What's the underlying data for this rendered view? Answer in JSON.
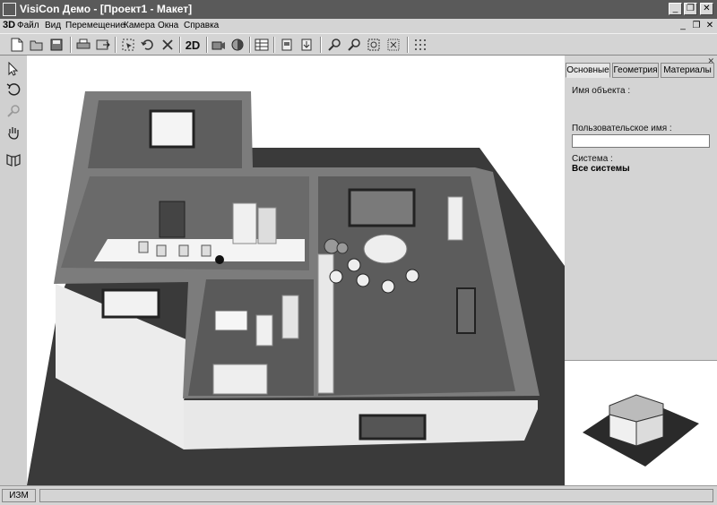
{
  "window": {
    "title": "VisiCon Демо - [Проект1 - Макет]",
    "min_glyph": "_",
    "restore_glyph": "❐",
    "close_glyph": "✕"
  },
  "menubar": {
    "logo": "3D",
    "items": [
      "Файл",
      "Вид",
      "Перемещение",
      "Камера",
      "Окна",
      "Справка"
    ],
    "mdi_min": "_",
    "mdi_restore": "❐",
    "mdi_close": "✕"
  },
  "toolbar": {
    "mode_2d_label": "2D",
    "icons": [
      "new-file-icon",
      "open-file-icon",
      "save-icon",
      "print-icon",
      "export-icon",
      "select-region-icon",
      "undo-icon",
      "delete-icon",
      "camera-view-icon",
      "render-icon",
      "table-grid-icon",
      "page-icon",
      "page-settings-icon",
      "zoom-in-icon",
      "zoom-out-icon",
      "zoom-extents-icon",
      "zoom-window-icon",
      "grid-icon"
    ]
  },
  "left_toolbar": {
    "icons": [
      "pointer-icon",
      "rotate-icon",
      "zoom-icon",
      "pan-hand-icon",
      "walk-through-icon"
    ]
  },
  "right_panel": {
    "close_glyph": "✕",
    "tabs": [
      "Основные",
      "Геометрия",
      "Материалы"
    ],
    "object_name_label": "Имя объекта :",
    "user_name_label": "Пользовательское имя :",
    "user_name_value": "",
    "system_label": "Система :",
    "system_value": "Все системы"
  },
  "status_bar": {
    "mode": "ИЗМ"
  },
  "colors": {
    "titlebar": "#5a5a5a",
    "floor_dark": "#3a3a3a",
    "room_floor": "#5c5c5c",
    "wall_top": "#7a7a7a",
    "wall_outer": "#ececec"
  }
}
